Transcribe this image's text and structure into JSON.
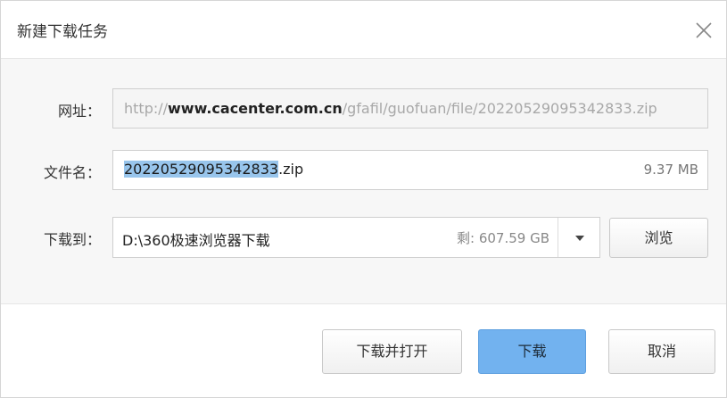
{
  "dialog": {
    "title": "新建下载任务",
    "close_icon": "close-icon"
  },
  "url": {
    "label": "网址：",
    "prefix": "http://",
    "host": "www.cacenter.com.cn",
    "path": "/gfafil/guofuan/file/20220529095342833.zip"
  },
  "filename": {
    "label": "文件名：",
    "name_selected": "20220529095342833",
    "extension": ".zip",
    "size": "9.37 MB"
  },
  "destination": {
    "label": "下载到：",
    "path": "D:\\360极速浏览器下载",
    "free_space": "剩: 607.59 GB",
    "dropdown_icon": "chevron-down-icon",
    "browse_label": "浏览"
  },
  "footer": {
    "download_open_label": "下载并打开",
    "download_label": "下载",
    "cancel_label": "取消"
  },
  "colors": {
    "primary_button": "#72b2ef",
    "selection": "#98c5ec"
  }
}
